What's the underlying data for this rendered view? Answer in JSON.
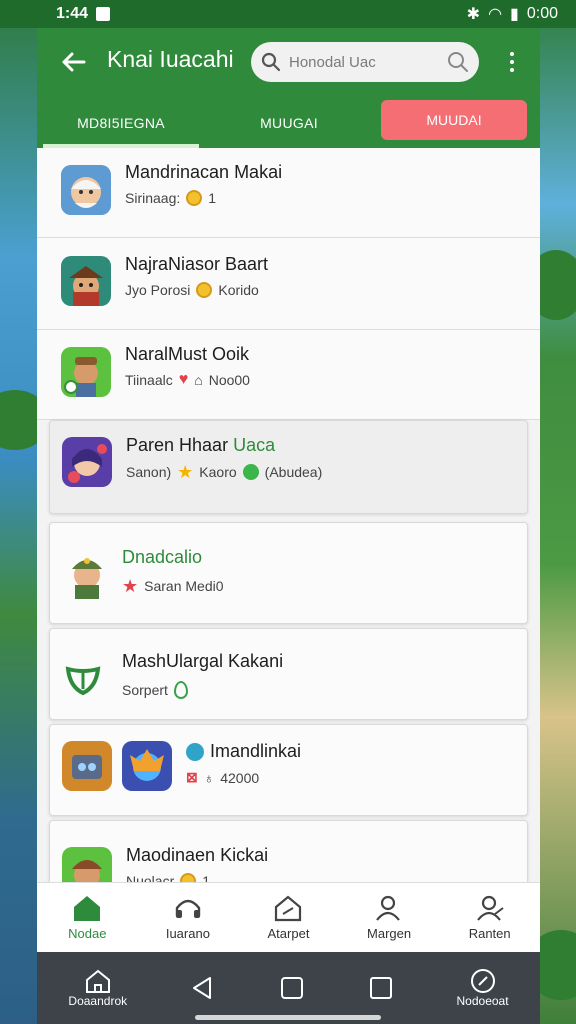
{
  "status_bar": {
    "time": "1:44",
    "battery_time": "0:00"
  },
  "app_bar": {
    "title": "Knai Iuacahi",
    "search_placeholder": "Honodal Uac",
    "tabs": [
      {
        "label": "MD8I5IEGNA"
      },
      {
        "label": "MUUGAI"
      },
      {
        "label": "MUUDAI"
      }
    ]
  },
  "list": [
    {
      "title": "Mandrinacan Makai",
      "sub": "Sirinaag:",
      "count": "1",
      "icon": "elder-avatar-icon"
    },
    {
      "title": "NajraNiasor Baart",
      "sub": "Jyo Porosi",
      "extra": "Korido",
      "icon": "pirate-avatar-icon"
    },
    {
      "title": "NaralMust Ooik",
      "sub": "Tiinaalc",
      "extra": "Noo00",
      "icon": "miner-avatar-icon"
    },
    {
      "title": "Paren Hhaar",
      "title_green": "Uaca",
      "sub": "Sanon)",
      "extra": "Kaoro",
      "extra2": "(Abudea)",
      "icon": "girl-avatar-icon"
    },
    {
      "title_green": "Dnadcalio",
      "sub": "Saran Medi0",
      "icon": "soldier-avatar-icon"
    },
    {
      "title": "MashUlargal Kakani",
      "sub": "Sorpert",
      "icon": "leaf-logo-icon"
    },
    {
      "title": "Imandlinkai",
      "extra": "42000",
      "icon": "robot-avatar-icon"
    },
    {
      "title": "Maodinaen Kickai",
      "sub": "Nuolacr",
      "count": "1",
      "icon": "hunter-avatar-icon"
    }
  ],
  "bottom_nav": [
    {
      "label": "Nodae",
      "icon": "home-icon",
      "active": true
    },
    {
      "label": "Iuarano",
      "icon": "headset-icon"
    },
    {
      "label": "Atarpet",
      "icon": "house-icon"
    },
    {
      "label": "Margen",
      "icon": "user-icon"
    },
    {
      "label": "Ranten",
      "icon": "user-edit-icon"
    }
  ],
  "system_nav": {
    "left_label": "Doaandrok",
    "right_label": "Nodoeoat"
  },
  "colors": {
    "primary": "#2f8a3b",
    "accent_pill": "#f46e73",
    "status_bar": "#1f6b2c"
  }
}
